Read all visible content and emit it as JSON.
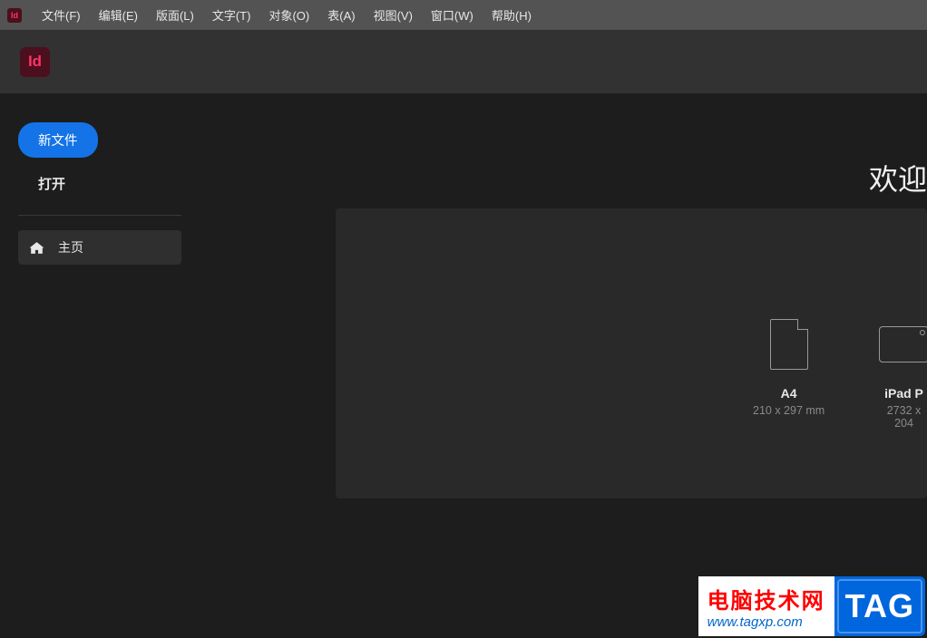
{
  "menubar": {
    "items": [
      "文件(F)",
      "编辑(E)",
      "版面(L)",
      "文字(T)",
      "对象(O)",
      "表(A)",
      "视图(V)",
      "窗口(W)",
      "帮助(H)"
    ]
  },
  "app": {
    "logo_text": "Id"
  },
  "sidebar": {
    "new_file": "新文件",
    "open": "打开",
    "nav": {
      "home": "主页"
    }
  },
  "content": {
    "welcome": "欢迎"
  },
  "presets": [
    {
      "name": "A4",
      "size": "210 x 297 mm"
    },
    {
      "name": "iPad P",
      "size": "2732 x 204"
    }
  ],
  "watermark": {
    "title": "电脑技术网",
    "url": "www.tagxp.com",
    "tag": "TAG"
  }
}
